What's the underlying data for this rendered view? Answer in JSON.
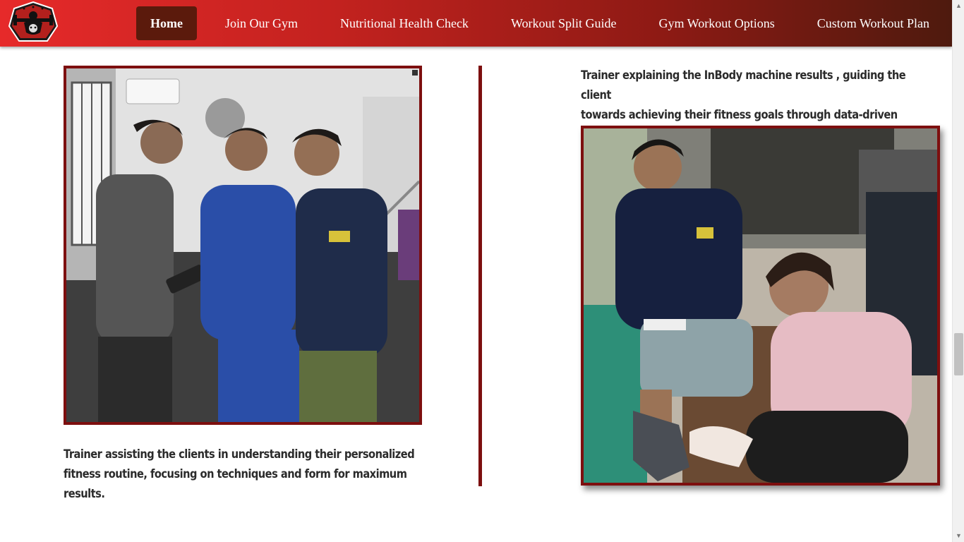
{
  "nav": {
    "logo_icon": "bodybuilder-logo-icon",
    "items": [
      {
        "label": "Home",
        "active": true
      },
      {
        "label": "Join Our Gym"
      },
      {
        "label": "Nutritional Health Check"
      },
      {
        "label": "Workout Split Guide"
      },
      {
        "label": "Gym Workout Options"
      },
      {
        "label": "Custom Workout Plan"
      }
    ]
  },
  "gallery": {
    "left": {
      "caption_line1": "Trainer assisting the clients in understanding their personalized",
      "caption_line2": "fitness routine, focusing on techniques and form for maximum results."
    },
    "right": {
      "caption_line1": "Trainer explaining the InBody machine results , guiding the client",
      "caption_line2": "towards achieving their fitness goals through data-driven insights."
    }
  },
  "colors": {
    "nav_gradient_start": "#e62a2a",
    "nav_gradient_end": "#4e1a0e",
    "active_tab": "#5b1a0c",
    "frame": "#7d0f0f"
  }
}
